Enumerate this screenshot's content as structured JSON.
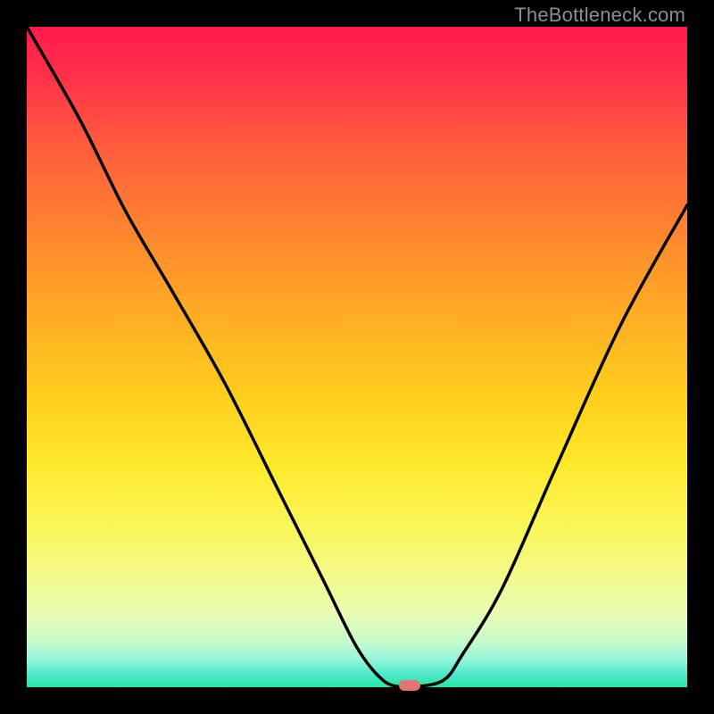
{
  "watermark": "TheBottleneck.com",
  "colors": {
    "curve": "#000000",
    "marker": "#e57373",
    "background": "#000000"
  },
  "chart_data": {
    "type": "line",
    "title": "",
    "xlabel": "",
    "ylabel": "",
    "xlim": [
      0,
      100
    ],
    "ylim": [
      0,
      100
    ],
    "grid": false,
    "legend": false,
    "series": [
      {
        "name": "bottleneck-curve",
        "x": [
          0,
          8,
          15,
          22,
          30,
          38,
          45,
          50,
          54,
          57,
          58,
          63,
          66,
          72,
          80,
          90,
          100
        ],
        "y": [
          100,
          86,
          72,
          60,
          46,
          30,
          16,
          6,
          1,
          0,
          0,
          1,
          5,
          15,
          33,
          55,
          73
        ]
      }
    ],
    "marker": {
      "x": 58,
      "y": 0
    }
  }
}
